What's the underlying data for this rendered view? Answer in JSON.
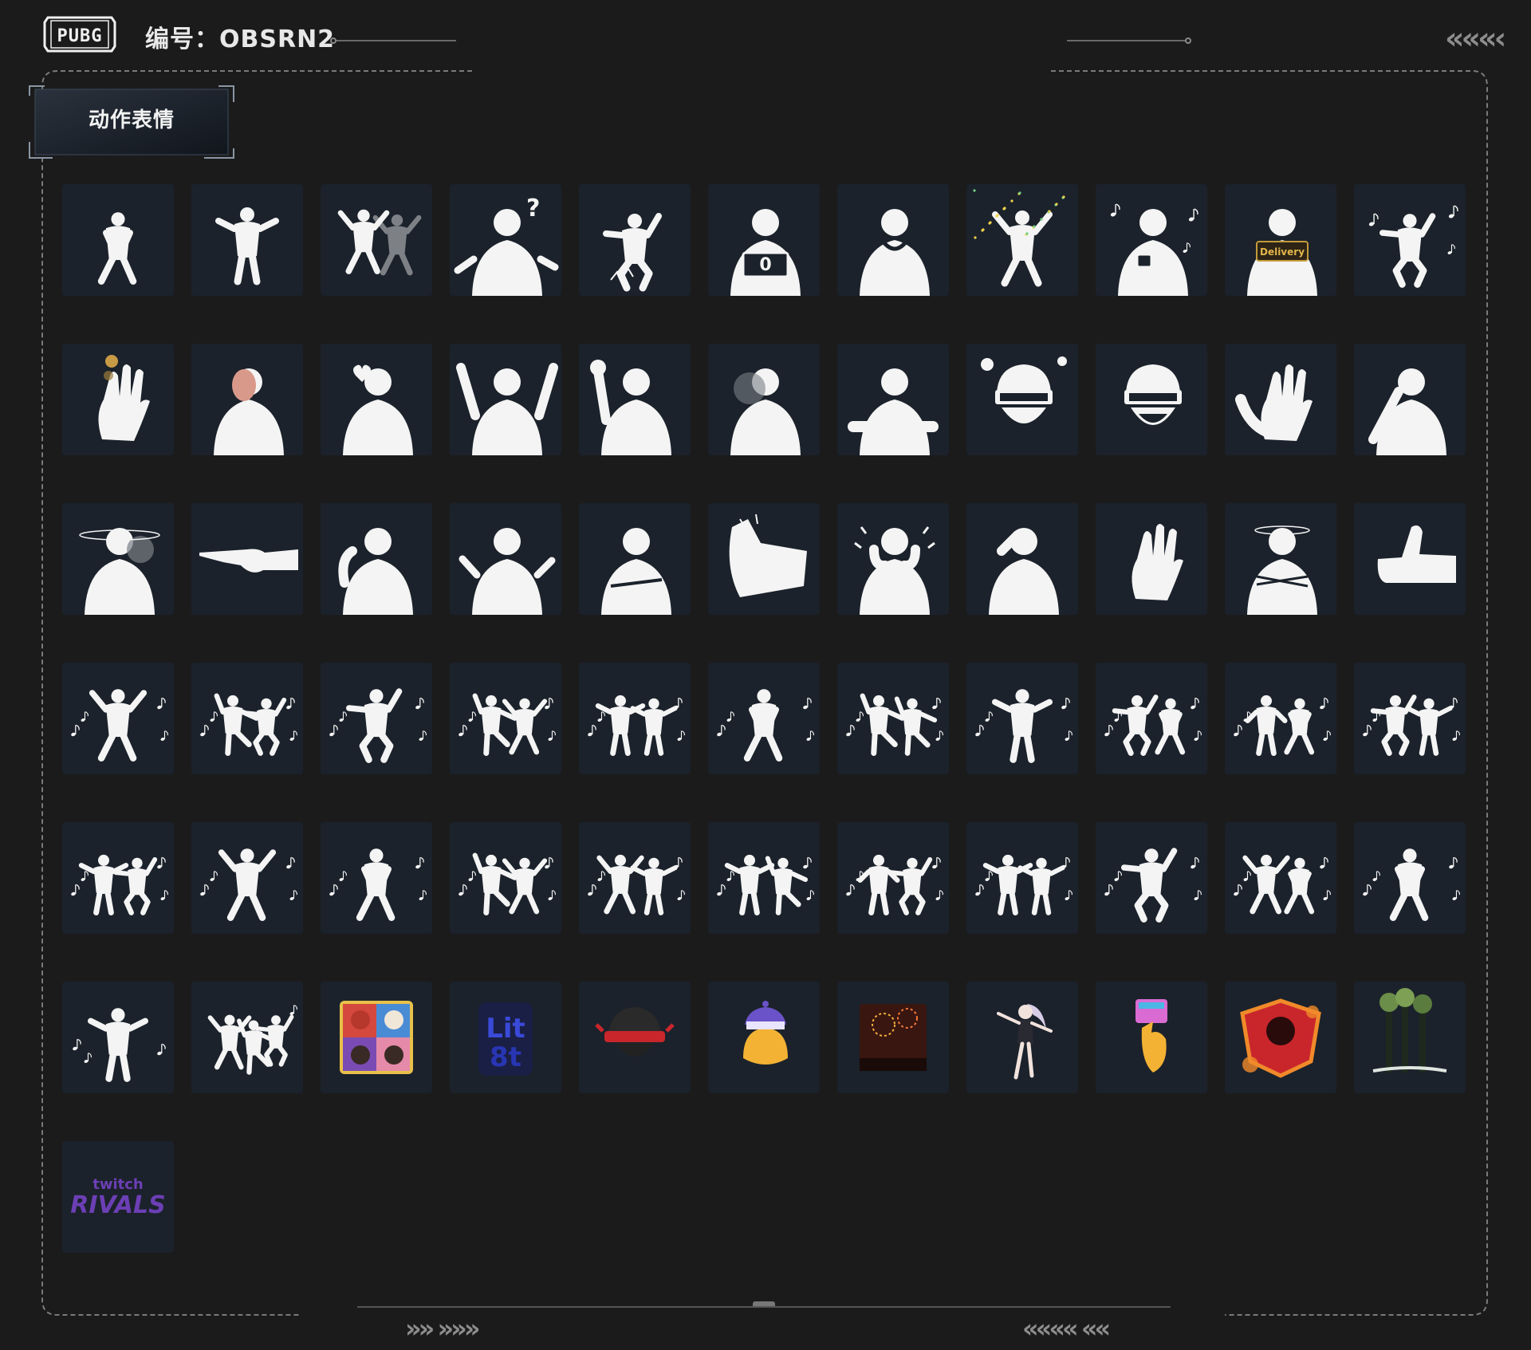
{
  "header": {
    "logo_text": "PUBG",
    "code_label": "编号：OBSRN2",
    "right_chevrons": "«««‹",
    "bottom_left_chevrons": "»» »»»",
    "bottom_right_chevrons": "«««« ««"
  },
  "tab": {
    "label": "动作表情"
  },
  "emotes": [
    {
      "icon": "crouch-figure-icon"
    },
    {
      "icon": "kungfu-stance-icon"
    },
    {
      "icon": "backflip-figure-icon"
    },
    {
      "icon": "confused-shrug-icon"
    },
    {
      "icon": "squat-smash-icon"
    },
    {
      "icon": "score-card-icon",
      "badge": "0"
    },
    {
      "icon": "prayer-figure-icon"
    },
    {
      "icon": "confetti-celebrate-icon"
    },
    {
      "icon": "tea-cup-icon"
    },
    {
      "icon": "delivery-box-icon",
      "badge": "Delivery"
    },
    {
      "icon": "kneel-music-icon"
    },
    {
      "icon": "coin-flip-icon"
    },
    {
      "icon": "mirror-figure-icon"
    },
    {
      "icon": "heart-hand-icon"
    },
    {
      "icon": "hands-up-icon"
    },
    {
      "icon": "wave-hand-icon"
    },
    {
      "icon": "head-turn-icon"
    },
    {
      "icon": "lean-arm-icon"
    },
    {
      "icon": "angry-helmet-icon"
    },
    {
      "icon": "laughing-helmet-icon"
    },
    {
      "icon": "clap-hands-icon"
    },
    {
      "icon": "facepalm-icon"
    },
    {
      "icon": "dizzy-head-icon"
    },
    {
      "icon": "point-finger-icon"
    },
    {
      "icon": "salute-icon"
    },
    {
      "icon": "shrug-icon"
    },
    {
      "icon": "arms-crossed-icon"
    },
    {
      "icon": "kick-icon"
    },
    {
      "icon": "cover-face-icon"
    },
    {
      "icon": "head-hold-icon"
    },
    {
      "icon": "stop-hand-icon"
    },
    {
      "icon": "cross-arms-spin-icon"
    },
    {
      "icon": "thumbs-up-icon"
    },
    {
      "icon": "dance-01-icon"
    },
    {
      "icon": "dance-02-icon"
    },
    {
      "icon": "dance-03-icon"
    },
    {
      "icon": "dance-04-icon"
    },
    {
      "icon": "dance-05-icon"
    },
    {
      "icon": "dance-06-icon"
    },
    {
      "icon": "dance-07-icon"
    },
    {
      "icon": "dance-08-icon"
    },
    {
      "icon": "dance-09-icon"
    },
    {
      "icon": "dance-10-icon"
    },
    {
      "icon": "dance-11-icon"
    },
    {
      "icon": "dance-12-icon"
    },
    {
      "icon": "dance-13-icon"
    },
    {
      "icon": "dance-14-icon"
    },
    {
      "icon": "dance-15-icon"
    },
    {
      "icon": "dance-16-icon"
    },
    {
      "icon": "dance-17-icon"
    },
    {
      "icon": "dance-18-icon"
    },
    {
      "icon": "dance-19-icon"
    },
    {
      "icon": "dance-20-icon"
    },
    {
      "icon": "dance-21-icon"
    },
    {
      "icon": "dance-22-icon"
    },
    {
      "icon": "ballet-dance-icon"
    },
    {
      "icon": "group-dance-icon"
    },
    {
      "icon": "anime-girls-icon"
    },
    {
      "icon": "lit-text-icon"
    },
    {
      "icon": "red-helmet-icon"
    },
    {
      "icon": "yellow-chick-icon"
    },
    {
      "icon": "fireworks-icon"
    },
    {
      "icon": "anime-dancer-icon"
    },
    {
      "icon": "airdrop-hand-icon"
    },
    {
      "icon": "flame-badge-icon"
    },
    {
      "icon": "forest-icon"
    },
    {
      "icon": "twitch-rivals-icon",
      "badge_top": "twitch",
      "badge_bottom": "RIVALS"
    }
  ],
  "colors": {
    "background": "#1b1b1c",
    "tile": "#1b222b",
    "frame": "#7a7a7a",
    "figure": "#f4f4f4",
    "twitch_purple": "#6c3fb5"
  }
}
